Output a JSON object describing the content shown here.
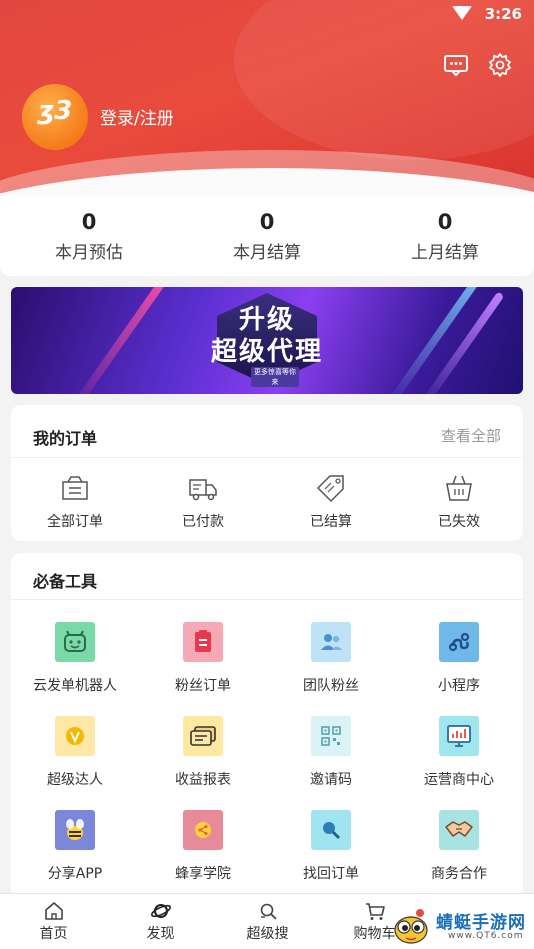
{
  "status": {
    "time": "3:26"
  },
  "header": {
    "login_label": "登录/注册"
  },
  "stats": [
    {
      "value": "0",
      "label": "本月预估"
    },
    {
      "value": "0",
      "label": "本月结算"
    },
    {
      "value": "0",
      "label": "上月结算"
    }
  ],
  "banner": {
    "line1": "升级",
    "line2": "超级代理",
    "cta": "更多惊喜等你来"
  },
  "orders": {
    "title": "我的订单",
    "view_all": "查看全部",
    "items": [
      {
        "label": "全部订单",
        "icon": "orders-list-icon"
      },
      {
        "label": "已付款",
        "icon": "delivery-truck-icon"
      },
      {
        "label": "已结算",
        "icon": "sale-tag-icon"
      },
      {
        "label": "已失效",
        "icon": "basket-icon"
      }
    ]
  },
  "tools": {
    "title": "必备工具",
    "items": [
      {
        "label": "云发单机器人",
        "icon": "robot-icon",
        "color": "#7ad9a8"
      },
      {
        "label": "粉丝订单",
        "icon": "clipboard-icon",
        "color": "#f6a9b4"
      },
      {
        "label": "团队粉丝",
        "icon": "team-icon",
        "color": "#bfe3f6"
      },
      {
        "label": "小程序",
        "icon": "mini-program-icon",
        "color": "#6fb8ea"
      },
      {
        "label": "超级达人",
        "icon": "expert-v-icon",
        "color": "#ffe7a8"
      },
      {
        "label": "收益报表",
        "icon": "report-cards-icon",
        "color": "#ffe9a0"
      },
      {
        "label": "邀请码",
        "icon": "qr-code-icon",
        "color": "#d9f3f7"
      },
      {
        "label": "运营商中心",
        "icon": "monitor-chart-icon",
        "color": "#9fe6ef"
      },
      {
        "label": "分享APP",
        "icon": "bee-icon",
        "color": "#7b88d9"
      },
      {
        "label": "蜂享学院",
        "icon": "share-school-icon",
        "color": "#e88a9a"
      },
      {
        "label": "找回订单",
        "icon": "magnifier-icon",
        "color": "#9fe4ef"
      },
      {
        "label": "商务合作",
        "icon": "handshake-icon",
        "color": "#a8e3e3"
      }
    ]
  },
  "tabbar": [
    {
      "label": "首页",
      "icon": "home-icon"
    },
    {
      "label": "发现",
      "icon": "planet-icon"
    },
    {
      "label": "超级搜",
      "icon": "super-search-icon"
    },
    {
      "label": "购物车",
      "icon": "cart-icon"
    }
  ],
  "watermark": {
    "text": "蜻蜓手游网",
    "url": "www.QT6.com"
  }
}
